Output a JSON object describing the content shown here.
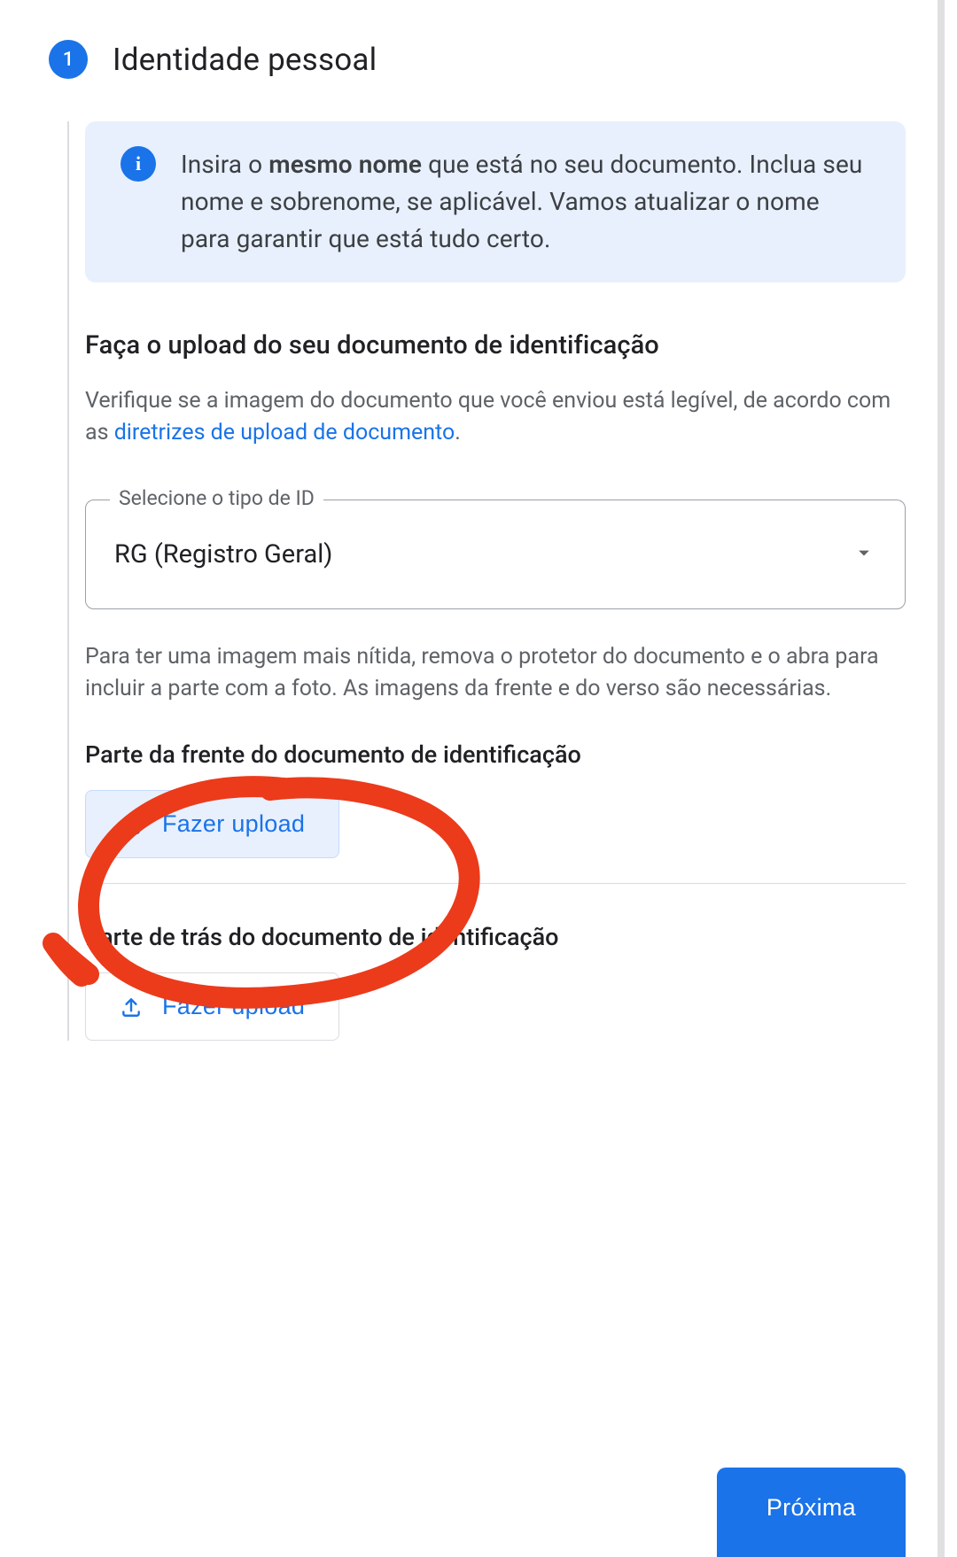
{
  "step": {
    "number": "1",
    "title": "Identidade pessoal"
  },
  "info": {
    "text_before": "Insira o ",
    "text_bold": "mesmo nome",
    "text_after": " que está no seu documento. Inclua seu nome e sobrenome, se aplicável. Vamos atualizar o nome para garantir que está tudo certo."
  },
  "upload_section": {
    "heading": "Faça o upload do seu documento de identificação",
    "verify_text_before": "Verifique se a imagem do documento que você enviou está legível, de acordo com as ",
    "verify_link": "diretrizes de upload de documento",
    "verify_text_after": "."
  },
  "id_select": {
    "label": "Selecione o tipo de ID",
    "value": "RG (Registro Geral)"
  },
  "hint": "Para ter uma imagem mais nítida, remova o protetor do documento e o abra para incluir a parte com a foto. As imagens da frente e do verso são necessárias.",
  "front": {
    "title": "Parte da frente do documento de identificação",
    "button": "Fazer upload"
  },
  "back": {
    "title": "Parte de trás do documento de identificação",
    "button": "Fazer upload"
  },
  "next_button": "Próxima",
  "colors": {
    "primary": "#1a73e8",
    "info_bg": "#e8f0fe"
  }
}
